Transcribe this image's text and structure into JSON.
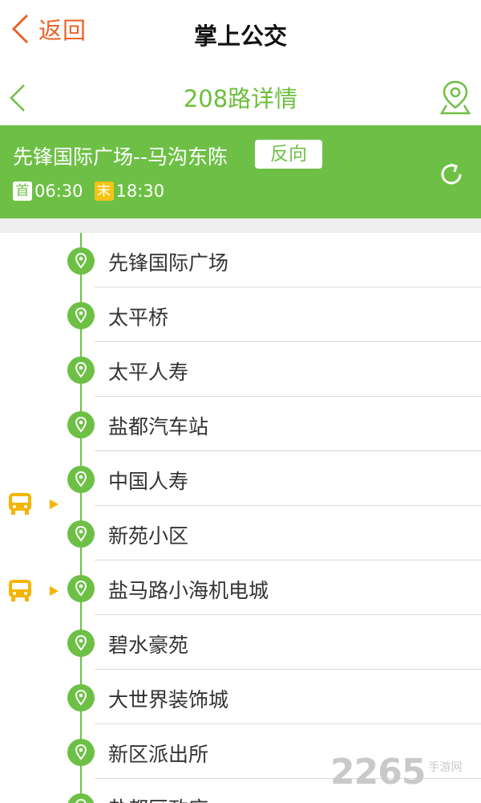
{
  "appbar": {
    "back_label": "返回",
    "title": "掌上公交"
  },
  "subbar": {
    "title": "208路详情"
  },
  "route": {
    "name": "先锋国际广场--马沟东陈",
    "reverse_label": "反向",
    "first_badge": "首",
    "first_time": "06:30",
    "last_badge": "末",
    "last_time": "18:30"
  },
  "stations": [
    "先锋国际广场",
    "太平桥",
    "太平人寿",
    "盐都汽车站",
    "中国人寿",
    "新苑小区",
    "盐马路小海机电城",
    "碧水豪苑",
    "大世界装饰城",
    "新区派出所",
    "盐都区政府"
  ],
  "watermark": {
    "number": "2265",
    "text": "手游网"
  },
  "colors": {
    "primary_green": "#6dc045",
    "accent_orange": "#e8642a",
    "bus_yellow": "#f5b400"
  },
  "icons": [
    "chevron-left-icon",
    "map-pin-icon",
    "refresh-icon",
    "location-pin-icon",
    "bus-icon"
  ]
}
